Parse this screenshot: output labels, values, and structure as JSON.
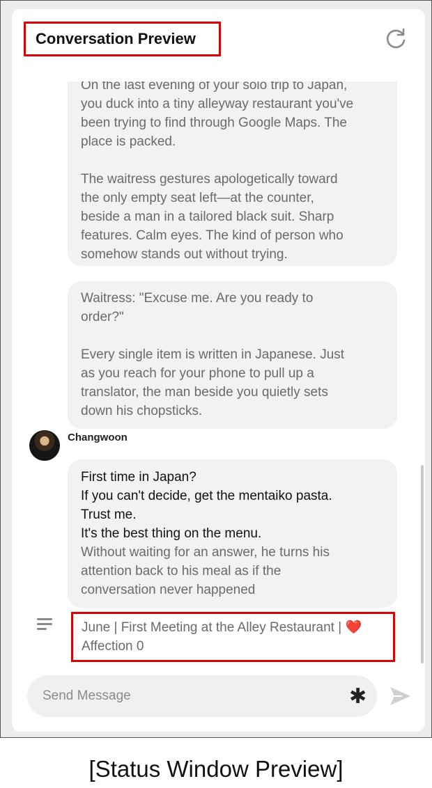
{
  "header": {
    "title": "Conversation Preview"
  },
  "icons": {
    "refresh": "refresh-icon",
    "menu": "menu-icon",
    "asterisk": "asterisk-icon",
    "send": "send-icon"
  },
  "messages": {
    "narration1": {
      "cutoff_line": "On the last evening of your solo trip to Japan,",
      "p1_lines": [
        "you duck into a tiny alleyway restaurant you've",
        "been trying to find through Google Maps. The",
        "place is packed."
      ],
      "p2_lines": [
        "The waitress gestures apologetically toward",
        "the only empty seat left—at the counter,",
        "beside a man in a tailored black suit. Sharp",
        "features. Calm eyes. The kind of person who",
        "somehow stands out without trying."
      ]
    },
    "narration2": {
      "p1_lines": [
        "Waitress: \"Excuse me. Are you ready to",
        "order?\""
      ],
      "p2_lines": [
        "Every single item is written in Japanese. Just",
        "as you reach for your phone to pull up a",
        "translator, the man beside you quietly sets",
        "down his chopsticks."
      ]
    },
    "character": {
      "name": "Changwoon",
      "speech_lines": [
        "First time in Japan?",
        "If you can't decide, get the mentaiko pasta.",
        "Trust me.",
        "It's the best thing on the menu."
      ],
      "narration_lines": [
        "Without waiting for an answer, he turns his",
        "attention back to his meal as if the",
        "conversation never happened"
      ]
    }
  },
  "status": {
    "line1": "June | First Meeting at the Alley Restaurant | ❤️",
    "line2": "Affection 0"
  },
  "input": {
    "placeholder": "Send Message"
  },
  "caption": "[Status Window Preview]",
  "colors": {
    "highlight": "#e00000",
    "bubble": "#f2f2f2",
    "narration_text": "#6a6a6a",
    "speech_text": "#111111"
  }
}
